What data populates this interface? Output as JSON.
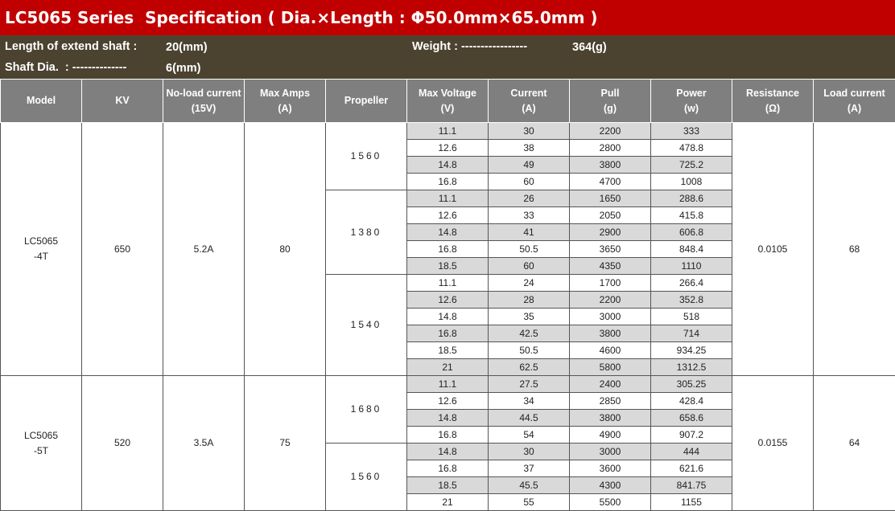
{
  "title": "LC5065 Series  Specification ( Dia.×Length : Φ50.0mm×65.0mm )",
  "info": {
    "extend_shaft_label": "Length of extend shaft :",
    "extend_shaft_value": "20(mm)",
    "weight_label": "Weight : -----------------",
    "weight_value": "364(g)",
    "shaft_dia_label": "Shaft Dia.  : --------------",
    "shaft_dia_value": "6(mm)"
  },
  "headers": [
    {
      "line1": "Model",
      "line2": ""
    },
    {
      "line1": "KV",
      "line2": ""
    },
    {
      "line1": "No-load current",
      "line2": "(15V)"
    },
    {
      "line1": "Max Amps",
      "line2": "(A)"
    },
    {
      "line1": "Propeller",
      "line2": ""
    },
    {
      "line1": "Max Voltage",
      "line2": "(V)"
    },
    {
      "line1": "Current",
      "line2": "(A)"
    },
    {
      "line1": "Pull",
      "line2": "(g)"
    },
    {
      "line1": "Power",
      "line2": "(w)"
    },
    {
      "line1": "Resistance",
      "line2": "(Ω)"
    },
    {
      "line1": "Load current",
      "line2": "(A)"
    }
  ],
  "models": [
    {
      "model_line1": "LC5065",
      "model_line2": "-4T",
      "kv": "650",
      "noload": "5.2A",
      "max_amps": "80",
      "resistance": "0.0105",
      "load_current": "68",
      "propellers": [
        {
          "name": "1560",
          "rows": [
            [
              "11.1",
              "30",
              "2200",
              "333"
            ],
            [
              "12.6",
              "38",
              "2800",
              "478.8"
            ],
            [
              "14.8",
              "49",
              "3800",
              "725.2"
            ],
            [
              "16.8",
              "60",
              "4700",
              "1008"
            ]
          ]
        },
        {
          "name": "1380",
          "rows": [
            [
              "11.1",
              "26",
              "1650",
              "288.6"
            ],
            [
              "12.6",
              "33",
              "2050",
              "415.8"
            ],
            [
              "14.8",
              "41",
              "2900",
              "606.8"
            ],
            [
              "16.8",
              "50.5",
              "3650",
              "848.4"
            ],
            [
              "18.5",
              "60",
              "4350",
              "1110"
            ]
          ]
        },
        {
          "name": "1540",
          "rows": [
            [
              "11.1",
              "24",
              "1700",
              "266.4"
            ],
            [
              "12.6",
              "28",
              "2200",
              "352.8"
            ],
            [
              "14.8",
              "35",
              "3000",
              "518"
            ],
            [
              "16.8",
              "42.5",
              "3800",
              "714"
            ],
            [
              "18.5",
              "50.5",
              "4600",
              "934.25"
            ],
            [
              "21",
              "62.5",
              "5800",
              "1312.5"
            ]
          ]
        }
      ]
    },
    {
      "model_line1": "LC5065",
      "model_line2": "-5T",
      "kv": "520",
      "noload": "3.5A",
      "max_amps": "75",
      "resistance": "0.0155",
      "load_current": "64",
      "propellers": [
        {
          "name": "1680",
          "rows": [
            [
              "11.1",
              "27.5",
              "2400",
              "305.25"
            ],
            [
              "12.6",
              "34",
              "2850",
              "428.4"
            ],
            [
              "14.8",
              "44.5",
              "3800",
              "658.6"
            ],
            [
              "16.8",
              "54",
              "4900",
              "907.2"
            ]
          ]
        },
        {
          "name": "1560",
          "rows": [
            [
              "14.8",
              "30",
              "3000",
              "444"
            ],
            [
              "16.8",
              "37",
              "3600",
              "621.6"
            ],
            [
              "18.5",
              "45.5",
              "4300",
              "841.75"
            ],
            [
              "21",
              "55",
              "5500",
              "1155"
            ]
          ]
        }
      ]
    }
  ]
}
